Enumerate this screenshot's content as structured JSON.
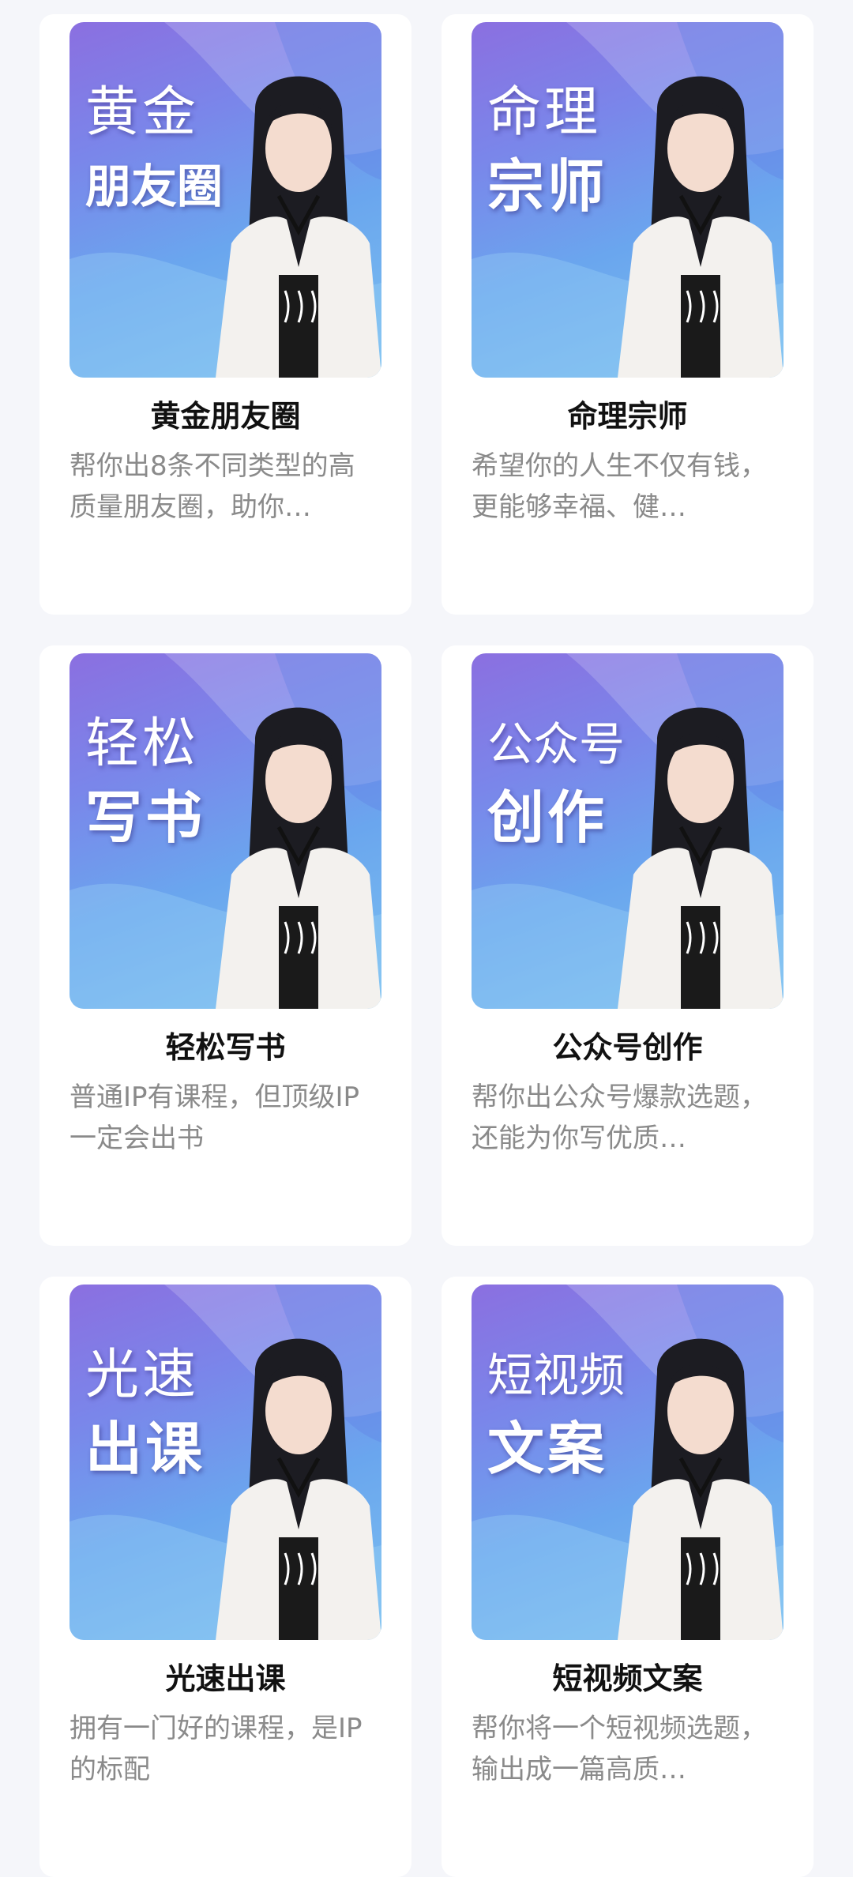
{
  "colors": {
    "page_bg": "#f5f6fa",
    "card_bg": "#ffffff",
    "title_text": "#111111",
    "desc_text": "#8a8a8a",
    "cover_gradient_start": "#8b6fe0",
    "cover_gradient_end": "#7cc0f0"
  },
  "cards": [
    {
      "cover_line1": "黄金",
      "cover_line2": "朋友圈",
      "title": "黄金朋友圈",
      "description": "帮你出8条不同类型的高质量朋友圈，助你…"
    },
    {
      "cover_line1": "命理",
      "cover_line2": "宗师",
      "title": "命理宗师",
      "description": "希望你的人生不仅有钱，更能够幸福、健…"
    },
    {
      "cover_line1": "轻松",
      "cover_line2": "写书",
      "title": "轻松写书",
      "description": "普通IP有课程，但顶级IP一定会出书"
    },
    {
      "cover_line1": "公众号",
      "cover_line2": "创作",
      "title": "公众号创作",
      "description": "帮你出公众号爆款选题，还能为你写优质…"
    },
    {
      "cover_line1": "光速",
      "cover_line2": "出课",
      "title": "光速出课",
      "description": "拥有一门好的课程，是IP的标配"
    },
    {
      "cover_line1": "短视频",
      "cover_line2": "文案",
      "title": "短视频文案",
      "description": "帮你将一个短视频选题，输出成一篇高质…"
    }
  ]
}
